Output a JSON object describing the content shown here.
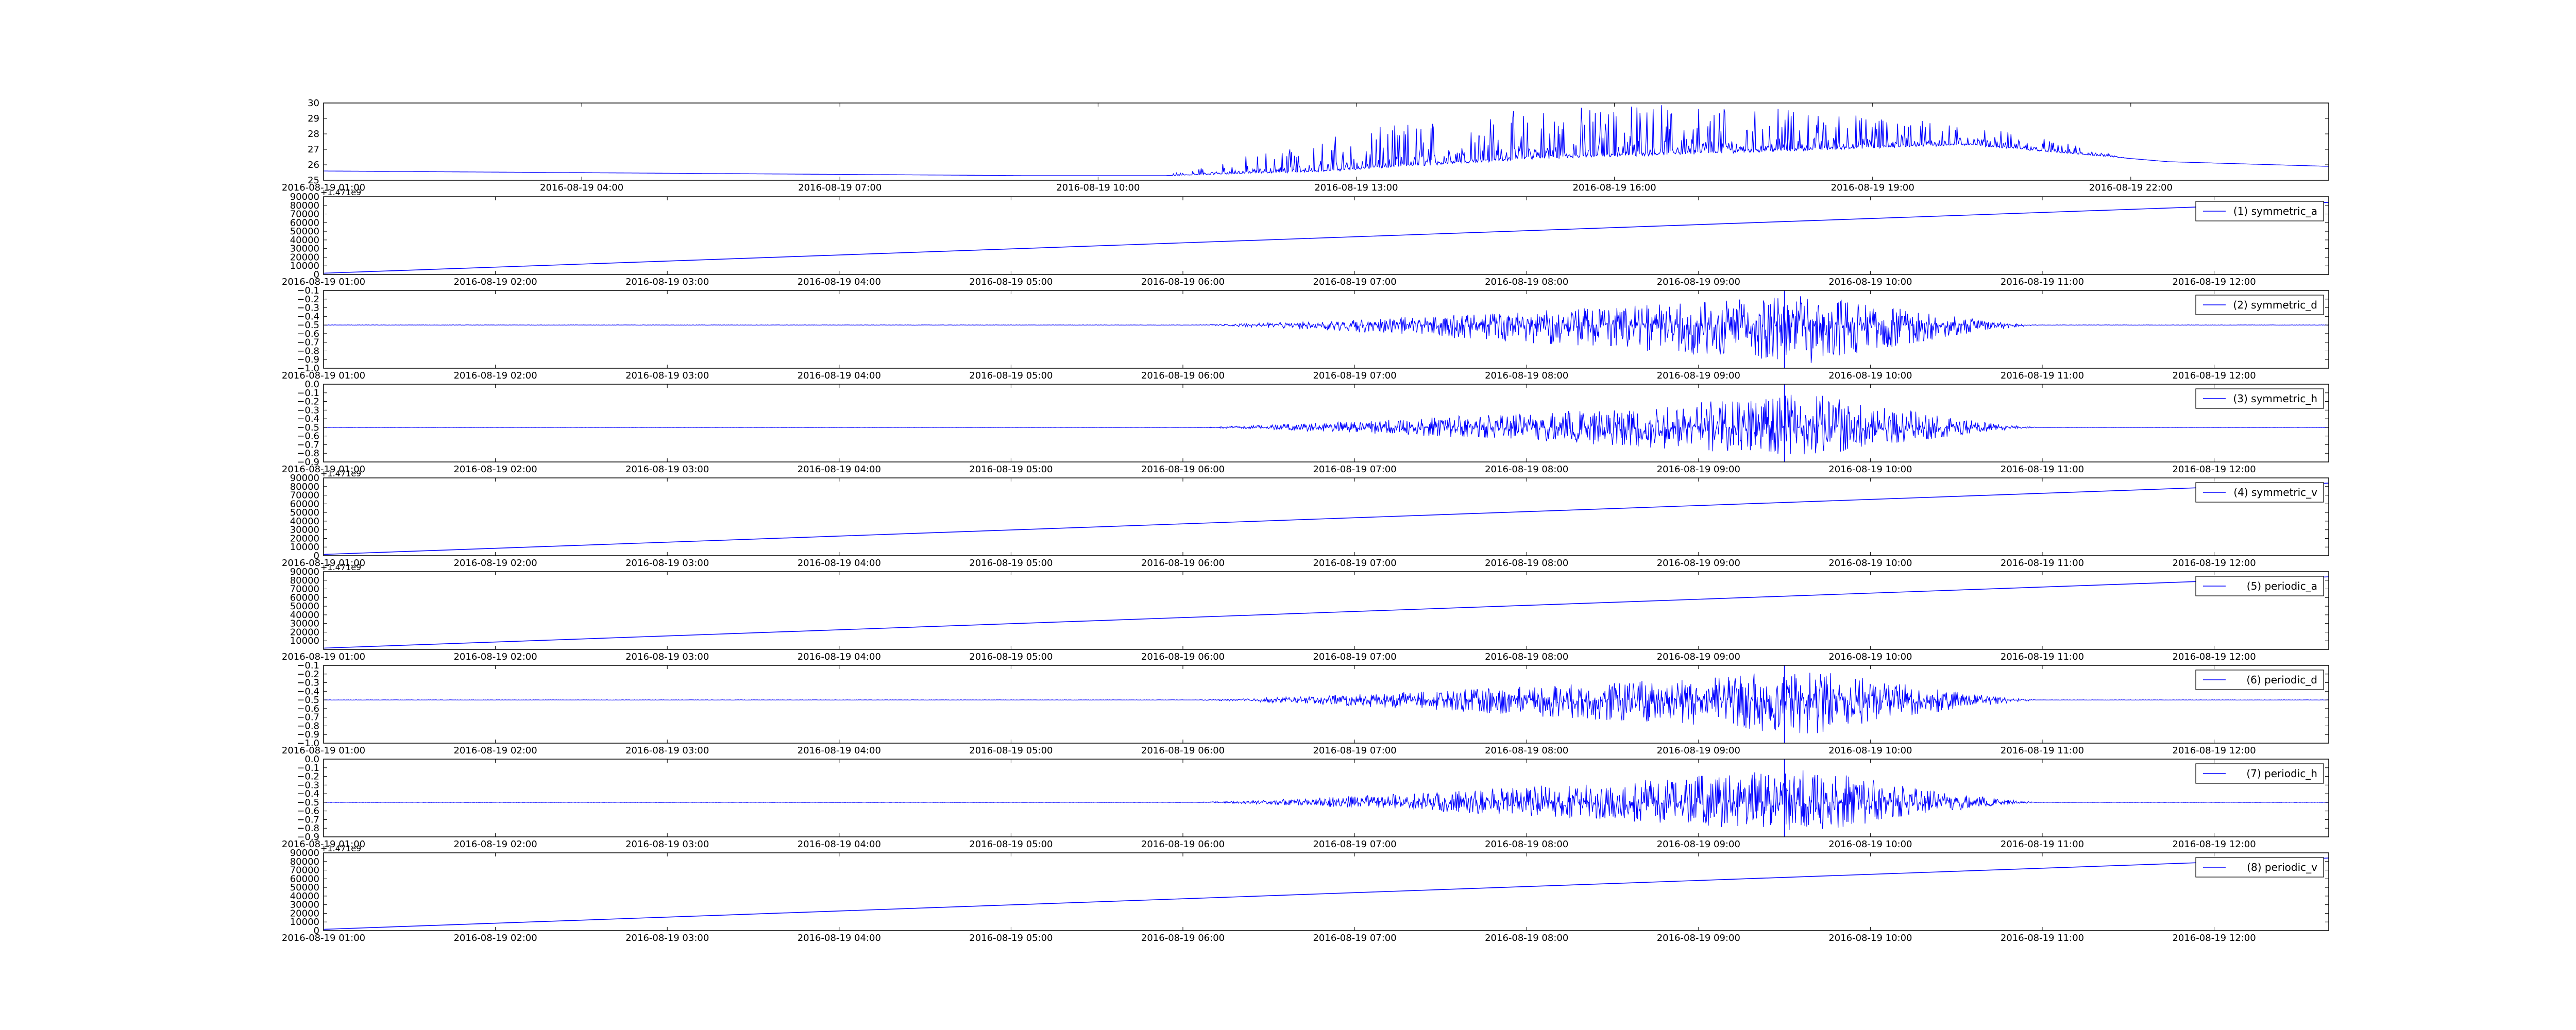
{
  "colors": {
    "series": "#0000ff",
    "axes": "#000000",
    "background": "#ffffff"
  },
  "chart_data": [
    {
      "type": "line",
      "title": "",
      "xlabel": "",
      "ylabel": "",
      "legend": null,
      "offset_text": "",
      "x_ticks": [
        "2016-08-19 01:00",
        "2016-08-19 04:00",
        "2016-08-19 07:00",
        "2016-08-19 10:00",
        "2016-08-19 13:00",
        "2016-08-19 16:00",
        "2016-08-19 19:00",
        "2016-08-19 22:00"
      ],
      "xlim": [
        "2016-08-19 01:00",
        "2016-08-20 00:18"
      ],
      "y_ticks": [
        "25",
        "26",
        "27",
        "28",
        "29",
        "30"
      ],
      "ylim": [
        25,
        30
      ],
      "shape": "temperature",
      "series": [
        {
          "values": {
            "start": "2016-08-19 01:00",
            "end": "2016-08-20 00:18",
            "baseline_profile": [
              [
                0.0,
                25.6
              ],
              [
                0.35,
                25.3
              ],
              [
                0.42,
                25.3
              ],
              [
                0.5,
                25.6
              ],
              [
                0.6,
                26.4
              ],
              [
                0.67,
                26.7
              ],
              [
                0.82,
                27.3
              ],
              [
                0.92,
                26.2
              ],
              [
                1.0,
                25.9
              ]
            ],
            "spike_range": [
              0.42,
              0.9
            ],
            "max_value": 29.9
          }
        }
      ]
    },
    {
      "type": "line",
      "title": "",
      "xlabel": "",
      "ylabel": "",
      "legend": "(1) symmetric_a",
      "legend_position": "top-right",
      "offset_text": "+1.471e9",
      "x_ticks": [
        "2016-08-19 01:00",
        "2016-08-19 02:00",
        "2016-08-19 03:00",
        "2016-08-19 04:00",
        "2016-08-19 05:00",
        "2016-08-19 06:00",
        "2016-08-19 07:00",
        "2016-08-19 08:00",
        "2016-08-19 09:00",
        "2016-08-19 10:00",
        "2016-08-19 11:00",
        "2016-08-19 12:00"
      ],
      "xlim": [
        "2016-08-19 01:00",
        "2016-08-19 12:40"
      ],
      "y_ticks": [
        "0",
        "10000",
        "20000",
        "30000",
        "40000",
        "50000",
        "60000",
        "70000",
        "80000",
        "90000"
      ],
      "ylim": [
        0,
        90000
      ],
      "shape": "linear",
      "series": [
        {
          "name": "(1) symmetric_a",
          "values": {
            "start": "2016-08-19 01:00",
            "end": "2016-08-19 12:40",
            "from": 1500,
            "to": 83500
          }
        }
      ]
    },
    {
      "type": "line",
      "title": "",
      "xlabel": "",
      "ylabel": "",
      "legend": "(2) symmetric_d",
      "legend_position": "top-right",
      "offset_text": "",
      "x_ticks": [
        "2016-08-19 01:00",
        "2016-08-19 02:00",
        "2016-08-19 03:00",
        "2016-08-19 04:00",
        "2016-08-19 05:00",
        "2016-08-19 06:00",
        "2016-08-19 07:00",
        "2016-08-19 08:00",
        "2016-08-19 09:00",
        "2016-08-19 10:00",
        "2016-08-19 11:00",
        "2016-08-19 12:00"
      ],
      "xlim": [
        "2016-08-19 01:00",
        "2016-08-19 12:40"
      ],
      "y_ticks": [
        "−1.0",
        "−0.9",
        "−0.8",
        "−0.7",
        "−0.6",
        "−0.5",
        "−0.4",
        "−0.3",
        "−0.2",
        "−0.1"
      ],
      "ylim": [
        -1.0,
        -0.1
      ],
      "shape": "oscillation",
      "series": [
        {
          "name": "(2) symmetric_d",
          "values": {
            "start": "2016-08-19 01:00",
            "end": "2016-08-19 12:40",
            "baseline": -0.5,
            "active_range": [
              "2016-08-19 06:00",
              "2016-08-19 11:00"
            ],
            "peak_time": "2016-08-19 09:40",
            "min_value": -0.95,
            "max_value": -0.15,
            "spike_time": "2016-08-19 09:30",
            "spike_range": [
              -1.0,
              -0.1
            ]
          }
        }
      ]
    },
    {
      "type": "line",
      "title": "",
      "xlabel": "",
      "ylabel": "",
      "legend": "(3) symmetric_h",
      "legend_position": "top-right",
      "offset_text": "",
      "x_ticks": [
        "2016-08-19 01:00",
        "2016-08-19 02:00",
        "2016-08-19 03:00",
        "2016-08-19 04:00",
        "2016-08-19 05:00",
        "2016-08-19 06:00",
        "2016-08-19 07:00",
        "2016-08-19 08:00",
        "2016-08-19 09:00",
        "2016-08-19 10:00",
        "2016-08-19 11:00",
        "2016-08-19 12:00"
      ],
      "xlim": [
        "2016-08-19 01:00",
        "2016-08-19 12:40"
      ],
      "y_ticks": [
        "−0.9",
        "−0.8",
        "−0.7",
        "−0.6",
        "−0.5",
        "−0.4",
        "−0.3",
        "−0.2",
        "−0.1",
        "0.0"
      ],
      "ylim": [
        -0.9,
        0.0
      ],
      "shape": "oscillation",
      "series": [
        {
          "name": "(3) symmetric_h",
          "values": {
            "start": "2016-08-19 01:00",
            "end": "2016-08-19 12:40",
            "baseline": -0.5,
            "active_range": [
              "2016-08-19 06:00",
              "2016-08-19 11:00"
            ],
            "peak_time": "2016-08-19 09:40",
            "min_value": -0.85,
            "max_value": -0.1,
            "spike_time": "2016-08-19 09:30",
            "spike_range": [
              -0.9,
              0.0
            ]
          }
        }
      ]
    },
    {
      "type": "line",
      "title": "",
      "xlabel": "",
      "ylabel": "",
      "legend": "(4) symmetric_v",
      "legend_position": "top-right",
      "offset_text": "+1.471e9",
      "x_ticks": [
        "2016-08-19 01:00",
        "2016-08-19 02:00",
        "2016-08-19 03:00",
        "2016-08-19 04:00",
        "2016-08-19 05:00",
        "2016-08-19 06:00",
        "2016-08-19 07:00",
        "2016-08-19 08:00",
        "2016-08-19 09:00",
        "2016-08-19 10:00",
        "2016-08-19 11:00",
        "2016-08-19 12:00"
      ],
      "xlim": [
        "2016-08-19 01:00",
        "2016-08-19 12:40"
      ],
      "y_ticks": [
        "0",
        "10000",
        "20000",
        "30000",
        "40000",
        "50000",
        "60000",
        "70000",
        "80000",
        "90000"
      ],
      "ylim": [
        0,
        90000
      ],
      "shape": "linear",
      "series": [
        {
          "name": "(4) symmetric_v",
          "values": {
            "start": "2016-08-19 01:00",
            "end": "2016-08-19 12:40",
            "from": 1500,
            "to": 84000
          }
        }
      ]
    },
    {
      "type": "line",
      "title": "",
      "xlabel": "",
      "ylabel": "",
      "legend": "(5) periodic_a",
      "legend_position": "top-right",
      "offset_text": "+1.471e9",
      "x_ticks": [
        "2016-08-19 01:00",
        "2016-08-19 02:00",
        "2016-08-19 03:00",
        "2016-08-19 04:00",
        "2016-08-19 05:00",
        "2016-08-19 06:00",
        "2016-08-19 07:00",
        "2016-08-19 08:00",
        "2016-08-19 09:00",
        "2016-08-19 10:00",
        "2016-08-19 11:00",
        "2016-08-19 12:00"
      ],
      "xlim": [
        "2016-08-19 01:00",
        "2016-08-19 12:40"
      ],
      "y_ticks": [
        "10000",
        "20000",
        "30000",
        "40000",
        "50000",
        "60000",
        "70000",
        "80000",
        "90000"
      ],
      "ylim": [
        0,
        90000
      ],
      "shape": "linear",
      "series": [
        {
          "name": "(5) periodic_a",
          "values": {
            "start": "2016-08-19 01:00",
            "end": "2016-08-19 12:40",
            "from": 1500,
            "to": 84000
          }
        }
      ]
    },
    {
      "type": "line",
      "title": "",
      "xlabel": "",
      "ylabel": "",
      "legend": "(6) periodic_d",
      "legend_position": "top-right",
      "offset_text": "",
      "x_ticks": [
        "2016-08-19 01:00",
        "2016-08-19 02:00",
        "2016-08-19 03:00",
        "2016-08-19 04:00",
        "2016-08-19 05:00",
        "2016-08-19 06:00",
        "2016-08-19 07:00",
        "2016-08-19 08:00",
        "2016-08-19 09:00",
        "2016-08-19 10:00",
        "2016-08-19 11:00",
        "2016-08-19 12:00"
      ],
      "xlim": [
        "2016-08-19 01:00",
        "2016-08-19 12:40"
      ],
      "y_ticks": [
        "−1.0",
        "−0.9",
        "−0.8",
        "−0.7",
        "−0.6",
        "−0.5",
        "−0.4",
        "−0.3",
        "−0.2",
        "−0.1"
      ],
      "ylim": [
        -1.0,
        -0.1
      ],
      "shape": "oscillation",
      "series": [
        {
          "name": "(6) periodic_d",
          "values": {
            "start": "2016-08-19 01:00",
            "end": "2016-08-19 12:40",
            "baseline": -0.5,
            "active_range": [
              "2016-08-19 06:00",
              "2016-08-19 11:00"
            ],
            "peak_time": "2016-08-19 09:40",
            "min_value": -0.9,
            "max_value": -0.15,
            "spike_time": "2016-08-19 09:30",
            "spike_range": [
              -1.0,
              -0.1
            ]
          }
        }
      ]
    },
    {
      "type": "line",
      "title": "",
      "xlabel": "",
      "ylabel": "",
      "legend": "(7) periodic_h",
      "legend_position": "top-right",
      "offset_text": "",
      "x_ticks": [
        "2016-08-19 01:00",
        "2016-08-19 02:00",
        "2016-08-19 03:00",
        "2016-08-19 04:00",
        "2016-08-19 05:00",
        "2016-08-19 06:00",
        "2016-08-19 07:00",
        "2016-08-19 08:00",
        "2016-08-19 09:00",
        "2016-08-19 10:00",
        "2016-08-19 11:00",
        "2016-08-19 12:00"
      ],
      "xlim": [
        "2016-08-19 01:00",
        "2016-08-19 12:40"
      ],
      "y_ticks": [
        "−0.9",
        "−0.8",
        "−0.7",
        "−0.6",
        "−0.5",
        "−0.4",
        "−0.3",
        "−0.2",
        "−0.1",
        "0.0"
      ],
      "ylim": [
        -0.9,
        0.0
      ],
      "shape": "oscillation",
      "series": [
        {
          "name": "(7) periodic_h",
          "values": {
            "start": "2016-08-19 01:00",
            "end": "2016-08-19 12:40",
            "baseline": -0.5,
            "active_range": [
              "2016-08-19 06:00",
              "2016-08-19 11:00"
            ],
            "peak_time": "2016-08-19 09:40",
            "min_value": -0.85,
            "max_value": -0.1,
            "spike_time": "2016-08-19 09:30",
            "spike_range": [
              -0.9,
              0.0
            ]
          }
        }
      ]
    },
    {
      "type": "line",
      "title": "",
      "xlabel": "",
      "ylabel": "",
      "legend": "(8) periodic_v",
      "legend_position": "top-right",
      "offset_text": "+1.471e9",
      "x_ticks": [
        "2016-08-19 01:00",
        "2016-08-19 02:00",
        "2016-08-19 03:00",
        "2016-08-19 04:00",
        "2016-08-19 05:00",
        "2016-08-19 06:00",
        "2016-08-19 07:00",
        "2016-08-19 08:00",
        "2016-08-19 09:00",
        "2016-08-19 10:00",
        "2016-08-19 11:00",
        "2016-08-19 12:00"
      ],
      "xlim": [
        "2016-08-19 01:00",
        "2016-08-19 12:40"
      ],
      "y_ticks": [
        "0",
        "10000",
        "20000",
        "30000",
        "40000",
        "50000",
        "60000",
        "70000",
        "80000",
        "90000"
      ],
      "ylim": [
        0,
        90000
      ],
      "shape": "linear",
      "series": [
        {
          "name": "(8) periodic_v",
          "values": {
            "start": "2016-08-19 01:00",
            "end": "2016-08-19 12:40",
            "from": 1500,
            "to": 84000
          }
        }
      ]
    }
  ]
}
